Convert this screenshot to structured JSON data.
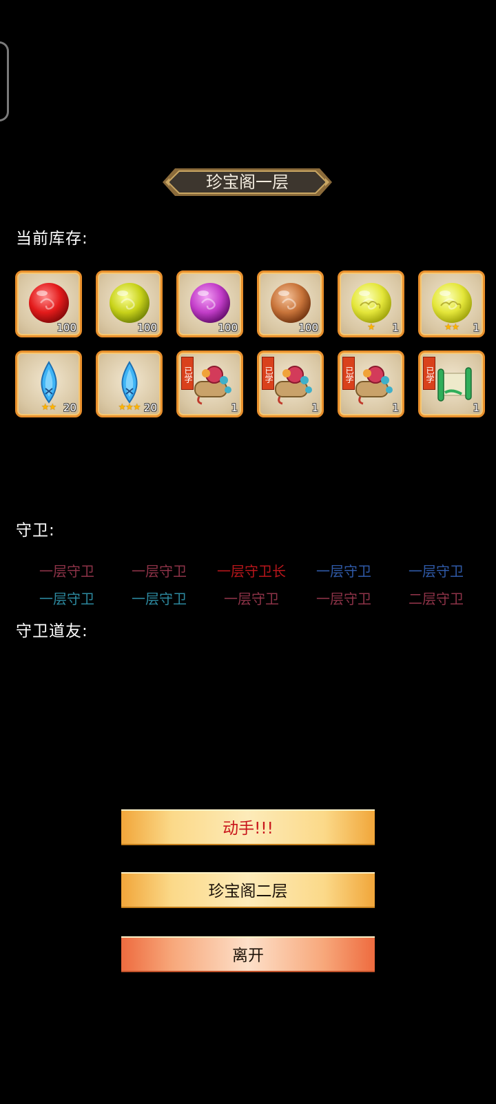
{
  "title": "珍宝阁一层",
  "inventory": {
    "label": "当前库存:",
    "items": [
      {
        "icon": "red-orb-icon",
        "count": "100",
        "stars": ""
      },
      {
        "icon": "yellow-orb-icon",
        "count": "100",
        "stars": ""
      },
      {
        "icon": "purple-orb-icon",
        "count": "100",
        "stars": ""
      },
      {
        "icon": "brown-orb-icon",
        "count": "100",
        "stars": ""
      },
      {
        "icon": "gold-cloud-orb-icon",
        "count": "1",
        "stars": "★"
      },
      {
        "icon": "gold-cloud-orb-icon",
        "count": "1",
        "stars": "★★"
      },
      {
        "icon": "blue-crystal-icon",
        "count": "20",
        "stars": "★★"
      },
      {
        "icon": "blue-crystal-icon",
        "count": "20",
        "stars": "★★★"
      },
      {
        "icon": "treasure-scroll-icon",
        "count": "1",
        "stars": "",
        "tag": "已学"
      },
      {
        "icon": "treasure-scroll-icon",
        "count": "1",
        "stars": "",
        "tag": "已学"
      },
      {
        "icon": "treasure-scroll-icon",
        "count": "1",
        "stars": "",
        "tag": "已学"
      },
      {
        "icon": "green-scroll-icon",
        "count": "1",
        "stars": "",
        "tag": "已学"
      }
    ]
  },
  "guards": {
    "label": "守卫:",
    "list": [
      {
        "name": "一层守卫",
        "color": "#8e3348"
      },
      {
        "name": "一层守卫",
        "color": "#8e3348"
      },
      {
        "name": "一层守卫长",
        "color": "#b8161b"
      },
      {
        "name": "一层守卫",
        "color": "#2f5aa8"
      },
      {
        "name": "一层守卫",
        "color": "#2f5aa8"
      },
      {
        "name": "一层守卫",
        "color": "#2d8aa0"
      },
      {
        "name": "一层守卫",
        "color": "#2d8aa0"
      },
      {
        "name": "一层守卫",
        "color": "#8e3348"
      },
      {
        "name": "一层守卫",
        "color": "#8e3348"
      },
      {
        "name": "二层守卫",
        "color": "#8e3348"
      }
    ]
  },
  "allies": {
    "label": "守卫道友:"
  },
  "buttons": {
    "attack": "动手!!!",
    "next_floor": "珍宝阁二层",
    "leave": "离开"
  },
  "colors": {
    "slot_border": "#e88f2c",
    "attack_text": "#c8141b"
  }
}
